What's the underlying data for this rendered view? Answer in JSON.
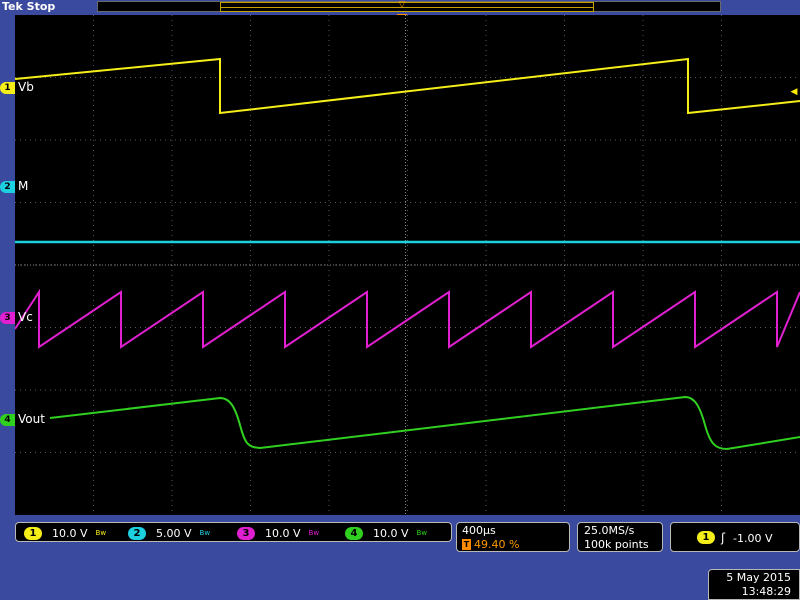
{
  "status": "Tek Stop",
  "colors": {
    "ch1": "#f5ee18",
    "ch2": "#1cd0e0",
    "ch3": "#e020d0",
    "ch4": "#30d020",
    "grid": "#5a5a5a",
    "trigger": "#ff8c00"
  },
  "channels": [
    {
      "num": "1",
      "label": "Vb",
      "scale": "10.0 V",
      "bw_symbol": "Bw"
    },
    {
      "num": "2",
      "label": "M",
      "scale": "5.00 V",
      "bw_symbol": "Bw"
    },
    {
      "num": "3",
      "label": "Vc",
      "scale": "10.0 V",
      "bw_symbol": "Bw"
    },
    {
      "num": "4",
      "label": "Vout",
      "scale": "10.0 V",
      "bw_symbol": "Bw"
    }
  ],
  "timebase": {
    "time_per_div": "400µs",
    "trigger_marker": "T",
    "trigger_position": "49.40 %"
  },
  "acquisition": {
    "sample_rate": "25.0MS/s",
    "record_length": "100k points"
  },
  "trigger": {
    "source": "1",
    "slope_icon": "rising-edge-icon",
    "slope_glyph": "ʃ",
    "level": "-1.00 V"
  },
  "datetime": {
    "date": "5 May 2015",
    "time": "13:48:29"
  },
  "markers": {
    "trig_position_glyph": "▽",
    "trig_T": "T",
    "ch1_level_arrow": "◀"
  }
}
